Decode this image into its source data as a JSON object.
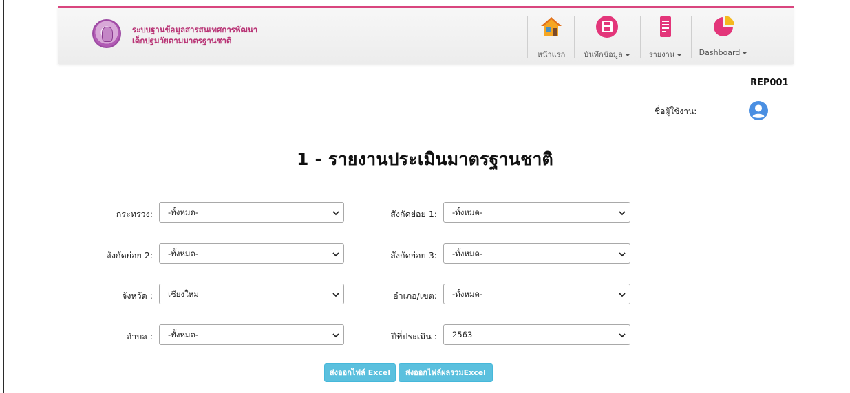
{
  "header": {
    "brand_line1": "ระบบฐานข้อมูลสารสนเทศการพัฒนา",
    "brand_line2": "เด็กปฐมวัยตามมาตรฐานชาติ",
    "nav": {
      "home": "หน้าแรก",
      "record": "บันทึกข้อมูล",
      "report": "รายงาน",
      "dashboard": "Dashboard"
    },
    "accent_color": "#d9457e"
  },
  "report_code": "REP001",
  "user": {
    "label": "ชื่อผู้ใช้งาน:"
  },
  "title": "1 - รายงานประเมินมาตรฐานชาติ",
  "form": {
    "ministry": {
      "label": "กระทรวง:",
      "value": "-ทั้งหมด-"
    },
    "sub1": {
      "label": "สังกัดย่อย 1:",
      "value": "-ทั้งหมด-"
    },
    "sub2": {
      "label": "สังกัดย่อย 2:",
      "value": "-ทั้งหมด-"
    },
    "sub3": {
      "label": "สังกัดย่อย 3:",
      "value": "-ทั้งหมด-"
    },
    "province": {
      "label": "จังหวัด :",
      "value": "เชียงใหม่"
    },
    "district": {
      "label": "อำเภอ/เขต:",
      "value": "-ทั้งหมด-"
    },
    "subdistrict": {
      "label": "ตำบล :",
      "value": "-ทั้งหมด-"
    },
    "year": {
      "label": "ปีที่ประเมิน :",
      "value": "2563"
    }
  },
  "buttons": {
    "export_excel": "ส่งออกไฟล์ Excel",
    "export_summary_excel": "ส่งออกไฟล์ผลรวมExcel"
  }
}
